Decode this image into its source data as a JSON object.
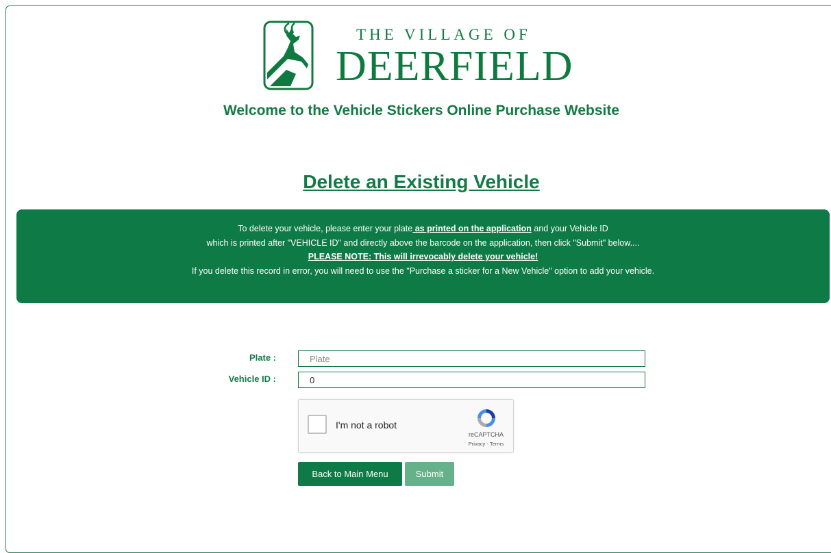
{
  "logo": {
    "line1": "THE VILLAGE OF",
    "line2": "DEERFIELD"
  },
  "welcome": "Welcome to the Vehicle Stickers Online Purchase Website",
  "page_title": "Delete an Existing Vehicle",
  "notice": {
    "l1_pre": "To delete your vehicle, please enter your plate",
    "l1_emph": " as printed on the application",
    "l1_post": " and your Vehicle ID",
    "l2": "which is printed after \"VEHICLE ID\" and directly above the barcode on the application, then click \"Submit\" below....",
    "l3": "PLEASE NOTE: This will irrevocably delete your vehicle!",
    "l4": "If you delete this record in error, you will need to use the \"Purchase a sticker for a New Vehicle\" option to add your vehicle."
  },
  "form": {
    "plate_label": "Plate :",
    "plate_placeholder": "Plate",
    "plate_value": "",
    "vehicle_id_label": "Vehicle ID :",
    "vehicle_id_value": "0"
  },
  "captcha": {
    "label": "I'm not a robot",
    "brand": "reCAPTCHA",
    "terms": "Privacy - Terms"
  },
  "buttons": {
    "back": "Back to Main Menu",
    "submit": "Submit"
  },
  "colors": {
    "brand_green": "#137a45",
    "notice_bg": "#0e7a45",
    "submit_disabled": "#66b08a"
  }
}
